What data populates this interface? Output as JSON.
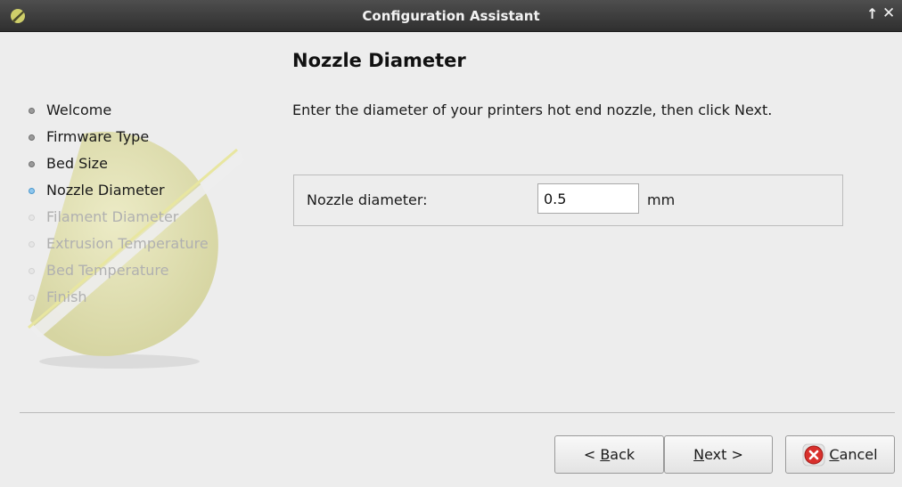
{
  "window": {
    "title": "Configuration Assistant",
    "controls": {
      "up": "↑",
      "close": "✕"
    }
  },
  "sidebar": {
    "steps": [
      {
        "label": "Welcome",
        "state": "done"
      },
      {
        "label": "Firmware Type",
        "state": "done"
      },
      {
        "label": "Bed Size",
        "state": "done"
      },
      {
        "label": "Nozzle Diameter",
        "state": "current"
      },
      {
        "label": "Filament Diameter",
        "state": "todo"
      },
      {
        "label": "Extrusion Temperature",
        "state": "todo"
      },
      {
        "label": "Bed Temperature",
        "state": "todo"
      },
      {
        "label": "Finish",
        "state": "todo"
      }
    ]
  },
  "page": {
    "title": "Nozzle Diameter",
    "description": "Enter the diameter of your printers hot end nozzle, then click Next.",
    "field": {
      "label": "Nozzle diameter:",
      "value": "0.5",
      "unit": "mm"
    }
  },
  "buttons": {
    "back": {
      "prefix": "< ",
      "mnemonic": "B",
      "rest": "ack"
    },
    "next": {
      "mnemonic": "N",
      "rest": "ext >"
    },
    "cancel": {
      "mnemonic": "C",
      "rest": "ancel",
      "icon": "cancel-icon"
    }
  },
  "colors": {
    "titlebar": "#3a3a3a",
    "current_step_bullet": "#8fc7ee",
    "cancel_icon": "#d9302c",
    "logo": "#d8d8a0"
  }
}
